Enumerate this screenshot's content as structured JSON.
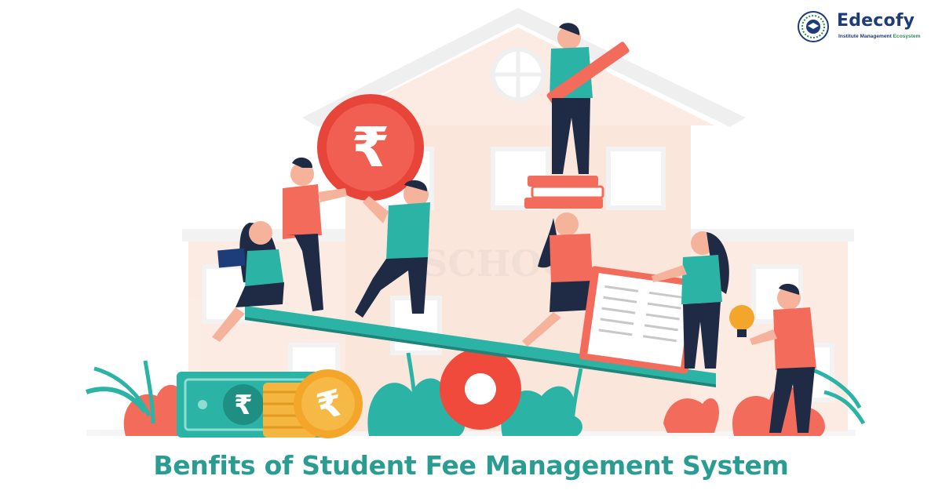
{
  "brand": {
    "name": "Edecofy",
    "tagline": "Institute Management",
    "tagline_accent": "Ecosystem"
  },
  "scene": {
    "building_sign": "SCHOOL",
    "currency_symbol": "₹"
  },
  "headline": "Benfits of Student Fee Management System",
  "colors": {
    "headline": "#2a9d93",
    "brand": "#1d3c7a",
    "coral": "#f26b5b",
    "teal": "#2bb3a5",
    "navy": "#1f2b45",
    "building": "#f6d8c8",
    "gold": "#f4a62a"
  }
}
